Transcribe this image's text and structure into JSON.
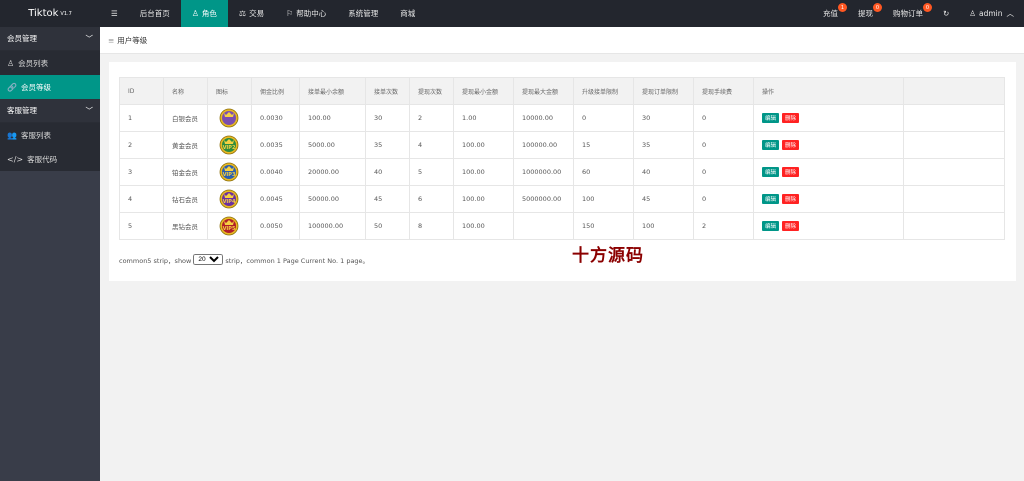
{
  "app": {
    "title": "Tiktok",
    "version": "V1.7"
  },
  "nav": [
    {
      "label": "后台首页",
      "icon": "menu-icon"
    },
    {
      "label": "角色",
      "icon": "user-icon"
    },
    {
      "label": "交易",
      "icon": "scale-icon"
    },
    {
      "label": "帮助中心",
      "icon": "flag-icon"
    },
    {
      "label": "系统管理",
      "icon": ""
    },
    {
      "label": "商城",
      "icon": ""
    }
  ],
  "right_nav": {
    "recharge": {
      "label": "充值",
      "count": "1"
    },
    "withdraw": {
      "label": "提现",
      "count": "0"
    },
    "orders": {
      "label": "购物订单",
      "count": "0"
    },
    "admin": "admin"
  },
  "sidebar": {
    "group1": "会员管理",
    "items1": [
      "会员列表",
      "会员等级"
    ],
    "group2": "客服管理",
    "items2": [
      "客服列表",
      "客服代码"
    ]
  },
  "breadcrumb": "用户等级",
  "table": {
    "headers": [
      "ID",
      "名称",
      "图标",
      "佣金比例",
      "接单最小余额",
      "接单次数",
      "提现次数",
      "提现最小金额",
      "提现最大金额",
      "升级接单限制",
      "提现订单限制",
      "提现手续费",
      "操作"
    ],
    "edit_label": "编辑",
    "delete_label": "删除",
    "rows": [
      {
        "id": "1",
        "name": "白银会员",
        "icon_text": "",
        "rate": "0.0030",
        "min_balance": "100.00",
        "orders": "30",
        "withdraw_times": "2",
        "wmin": "1.00",
        "wmax": "10000.00",
        "upgrade": "0",
        "worder": "30",
        "fee": "0",
        "color": "#7b4fb0"
      },
      {
        "id": "2",
        "name": "黄金会员",
        "icon_text": "VIP2",
        "rate": "0.0035",
        "min_balance": "5000.00",
        "orders": "35",
        "withdraw_times": "4",
        "wmin": "100.00",
        "wmax": "100000.00",
        "upgrade": "15",
        "worder": "35",
        "fee": "0",
        "color": "#2e8b3e"
      },
      {
        "id": "3",
        "name": "铂金会员",
        "icon_text": "VIP3",
        "rate": "0.0040",
        "min_balance": "20000.00",
        "orders": "40",
        "withdraw_times": "5",
        "wmin": "100.00",
        "wmax": "1000000.00",
        "upgrade": "60",
        "worder": "40",
        "fee": "0",
        "color": "#2a5db0"
      },
      {
        "id": "4",
        "name": "钻石会员",
        "icon_text": "VIP4",
        "rate": "0.0045",
        "min_balance": "50000.00",
        "orders": "45",
        "withdraw_times": "6",
        "wmin": "100.00",
        "wmax": "5000000.00",
        "upgrade": "100",
        "worder": "45",
        "fee": "0",
        "color": "#6a2fa0"
      },
      {
        "id": "5",
        "name": "黑钻会员",
        "icon_text": "VIP5",
        "rate": "0.0050",
        "min_balance": "100000.00",
        "orders": "50",
        "withdraw_times": "8",
        "wmin": "100.00",
        "wmax": "",
        "upgrade": "150",
        "worder": "100",
        "fee": "2",
        "color": "#b01e2a"
      }
    ]
  },
  "pager": {
    "prefix": "common5 strip，show",
    "selected": "20",
    "suffix": "strip，common 1 Page Current No. 1 page。"
  },
  "watermark": "十方源码"
}
